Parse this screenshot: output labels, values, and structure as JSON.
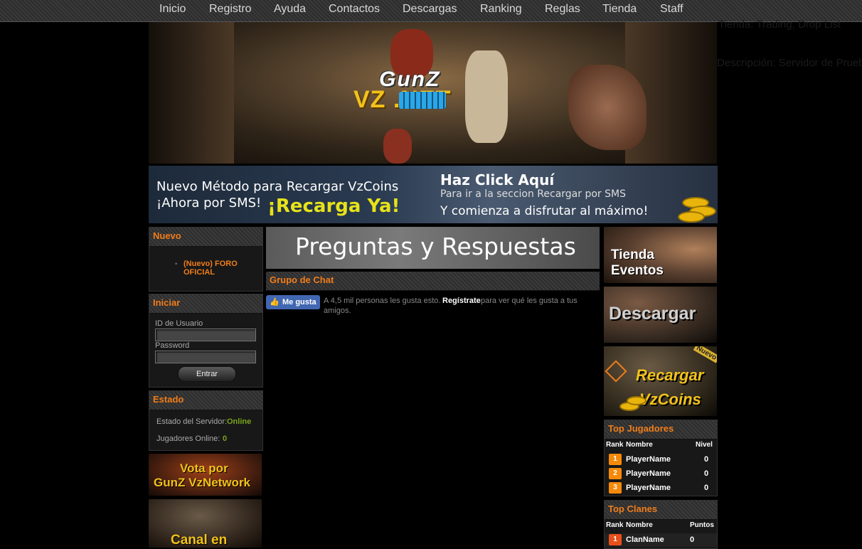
{
  "nav": {
    "items": [
      "Inicio",
      "Registro",
      "Ayuda",
      "Contactos",
      "Descargas",
      "Ranking",
      "Reglas",
      "Tienda",
      "Staff"
    ]
  },
  "stray_text": [
    "Tienda: Trading, Drop List",
    "Descripción: Servidor de Pruebas: Tu"
  ],
  "header": {
    "logo_top": "GunZ",
    "logo_bottom": "VZ     .NET"
  },
  "sms_banner": {
    "line1": "Nuevo Método para Recargar VzCoins",
    "line2": "¡Ahora por SMS!",
    "cta": "¡Recarga Ya!",
    "click_title": "Haz Click Aquí",
    "click_sub": "Para ir a la seccion Recargar por SMS",
    "click_sub2": "Y comienza a disfrutar al máximo!"
  },
  "nuevo": {
    "title": "Nuevo",
    "items": [
      "(Nuevo) FORO OFICIAL"
    ]
  },
  "iniciar": {
    "title": "Iniciar",
    "user_label": "ID de Usuario",
    "pass_label": "Password",
    "button": "Entrar"
  },
  "estado": {
    "title": "Estado",
    "server_label": "Estado del Servidor:",
    "server_value": "Online",
    "players_label": "Jugadores Online:",
    "players_value": "0"
  },
  "vote_banner": {
    "line1": "Vota por",
    "line2": "GunZ VzNetwork"
  },
  "canal_banner": {
    "line1": "Canal en"
  },
  "faq_banner": "Preguntas y Respuestas",
  "chat": {
    "title": "Grupo de Chat",
    "like_button": "Me gusta",
    "like_text1": "A 4,5 mil personas les gusta esto.",
    "like_link": "Regístrate",
    "like_text2": "para ver qué les gusta a tus",
    "like_text3": "amigos."
  },
  "right_banners": {
    "tienda": [
      "Tienda",
      "Eventos"
    ],
    "descargar": "Descargar",
    "recargar": [
      "Recargar",
      "VzCoins"
    ],
    "recargar_tag": "Nuevo"
  },
  "top_jugadores": {
    "title": "Top Jugadores",
    "headers": [
      "Rank",
      "Nombre",
      "Nivel"
    ],
    "rows": [
      {
        "rank": "1",
        "name": "PlayerName",
        "value": "0"
      },
      {
        "rank": "2",
        "name": "PlayerName",
        "value": "0"
      },
      {
        "rank": "3",
        "name": "PlayerName",
        "value": "0"
      }
    ]
  },
  "top_clanes": {
    "title": "Top Clanes",
    "headers": [
      "Rank",
      "Nombre",
      "Puntos"
    ],
    "rows": [
      {
        "rank": "1",
        "name": "ClanName",
        "value": "0"
      }
    ]
  },
  "colors": {
    "accent": "#f07d1a",
    "online": "#7aa51a",
    "gold": "#f2c21a"
  }
}
